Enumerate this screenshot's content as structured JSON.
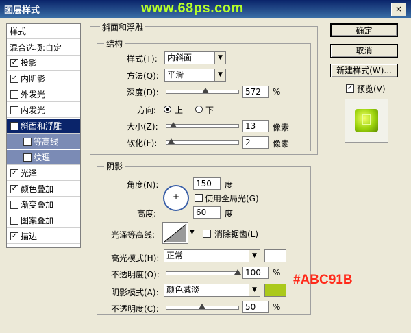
{
  "window": {
    "title": "图层样式",
    "watermark": "www.68ps.com",
    "close": "×"
  },
  "styles_panel": {
    "header": "样式",
    "blend_options": "混合选项:自定",
    "items": [
      {
        "label": "投影",
        "checked": true
      },
      {
        "label": "内阴影",
        "checked": true
      },
      {
        "label": "外发光",
        "checked": false
      },
      {
        "label": "内发光",
        "checked": false
      },
      {
        "label": "斜面和浮雕",
        "checked": true,
        "selected": true
      },
      {
        "label": "等高线",
        "checked": true,
        "sub": true
      },
      {
        "label": "纹理",
        "checked": false,
        "sub": true
      },
      {
        "label": "光泽",
        "checked": true
      },
      {
        "label": "颜色叠加",
        "checked": true
      },
      {
        "label": "渐变叠加",
        "checked": false
      },
      {
        "label": "图案叠加",
        "checked": false
      },
      {
        "label": "描边",
        "checked": true
      }
    ],
    "check_mark": "✓"
  },
  "bevel": {
    "group_title": "斜面和浮雕",
    "structure_title": "结构",
    "style_label": "样式(T):",
    "style_value": "内斜面",
    "technique_label": "方法(Q):",
    "technique_value": "平滑",
    "depth_label": "深度(D):",
    "depth_value": "572",
    "depth_level": 0.55,
    "percent": "%",
    "direction_label": "方向:",
    "direction_up": "上",
    "direction_down": "下",
    "size_label": "大小(Z):",
    "size_value": "13",
    "size_level": 0.1,
    "px_unit": "像素",
    "soften_label": "软化(F):",
    "soften_value": "2",
    "soften_level": 0.08,
    "px_unit2": "像素"
  },
  "shading": {
    "title": "阴影",
    "angle_label": "角度(N):",
    "angle_value": "150",
    "degree": "度",
    "global_light": "使用全局光(G)",
    "altitude_label": "高度:",
    "altitude_value": "60",
    "degree2": "度",
    "gloss_label": "光泽等高线:",
    "anti_alias": "消除锯齿(L)",
    "highlight_label": "高光模式(H):",
    "highlight_mode": "正常",
    "highlight_color": "#ffffff",
    "opacity1_label": "不透明度(O):",
    "opacity1_value": "100",
    "opacity1_level": 1.0,
    "percent1": "%",
    "shadow_label": "阴影模式(A):",
    "shadow_mode": "颜色减淡",
    "shadow_color": "#abc91b",
    "shadow_color_note": "#ABC91B",
    "opacity2_label": "不透明度(C):",
    "opacity2_value": "50",
    "opacity2_level": 0.5,
    "percent2": "%"
  },
  "buttons": {
    "ok": "确定",
    "cancel": "取消",
    "new_style": "新建样式(W)..."
  },
  "preview": {
    "label": "预览(V)",
    "checked": true,
    "check_mark": "✓"
  }
}
